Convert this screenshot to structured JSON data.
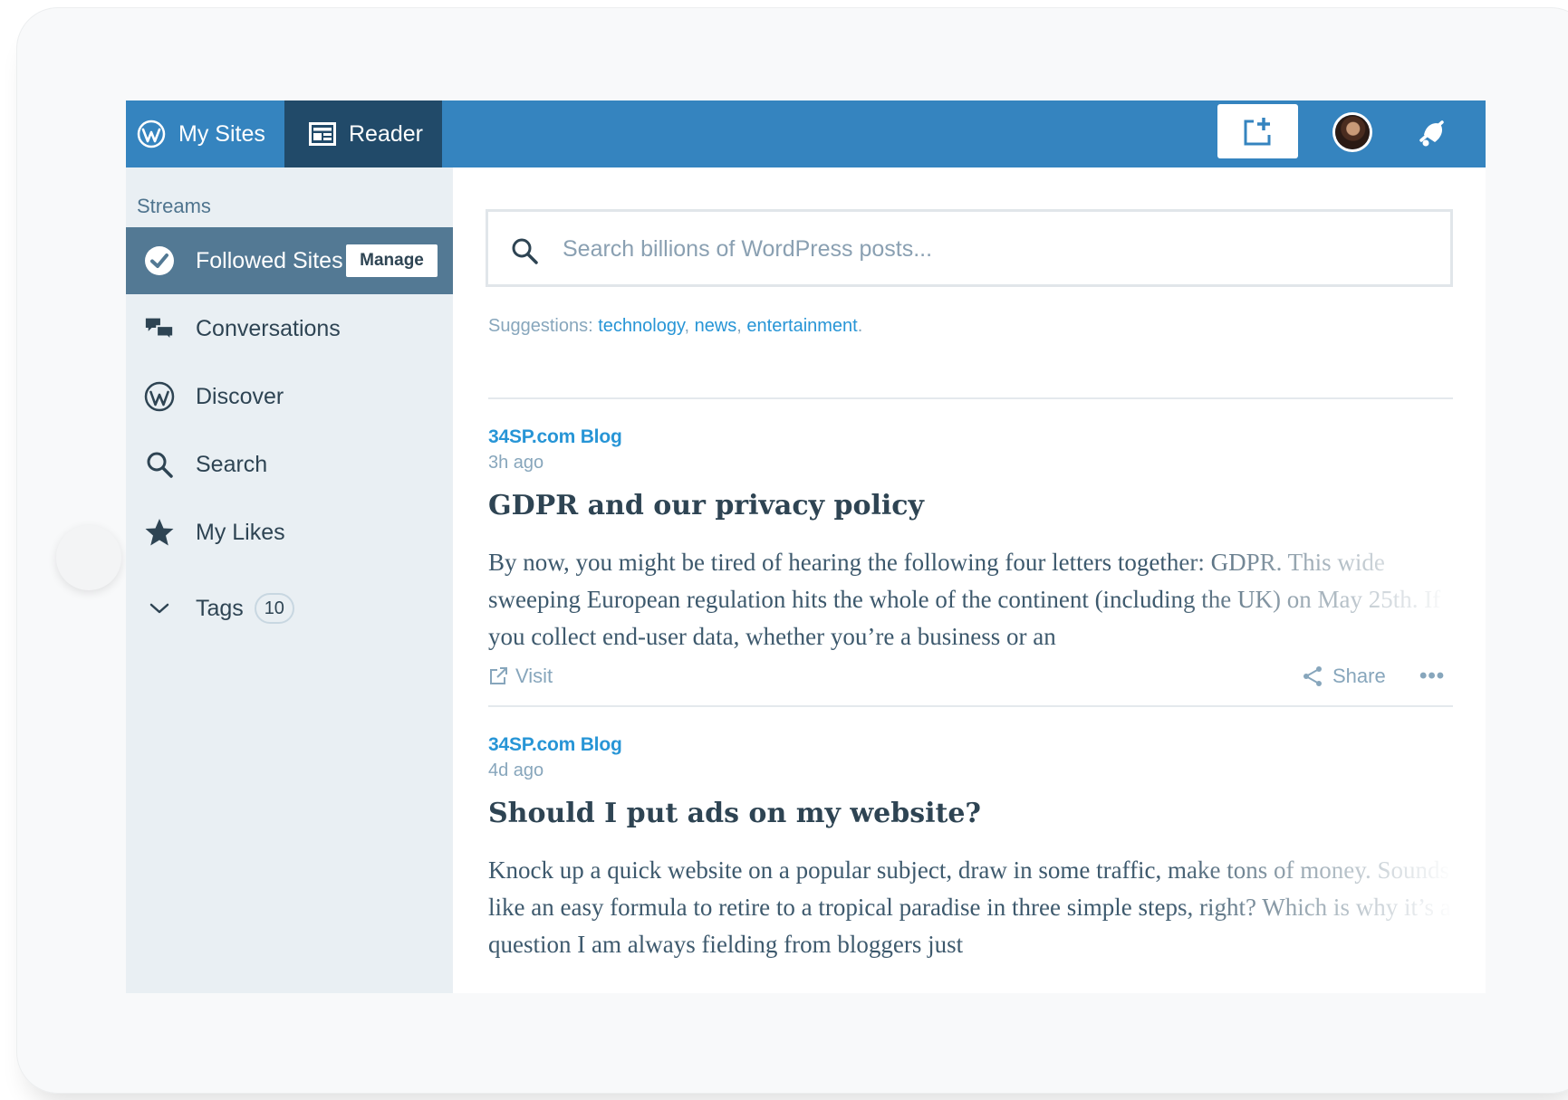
{
  "masterbar": {
    "my_sites_label": "My Sites",
    "reader_label": "Reader",
    "write_icon": "write-post-icon",
    "avatar_icon": "user-avatar",
    "notifications_icon": "notifications-bell-icon",
    "colors": {
      "bar": "#3584bf",
      "active_tab": "#214a69"
    }
  },
  "sidebar": {
    "streams_label": "Streams",
    "items": [
      {
        "label": "Followed Sites",
        "icon": "checkmark-circle-icon",
        "active": true,
        "action_label": "Manage"
      },
      {
        "label": "Conversations",
        "icon": "conversations-icon"
      },
      {
        "label": "Discover",
        "icon": "wordpress-logo-icon"
      },
      {
        "label": "Search",
        "icon": "search-icon"
      },
      {
        "label": "My Likes",
        "icon": "star-icon"
      }
    ],
    "tags": {
      "label": "Tags",
      "count": "10",
      "icon": "chevron-down-icon"
    }
  },
  "search": {
    "placeholder": "Search billions of WordPress posts...",
    "value": ""
  },
  "suggestions": {
    "label": "Suggestions:",
    "items": [
      "technology",
      "news",
      "entertainment"
    ]
  },
  "posts": [
    {
      "site": "34SP.com Blog",
      "time": "3h ago",
      "title": "GDPR and our privacy policy",
      "excerpt": "By now, you might be tired of hearing the following four letters together: GDPR. This wide sweeping European regulation hits the whole of the continent (including the UK) on May 25th. If you collect end-user data, whether you’re a business or an",
      "visit_label": "Visit",
      "share_label": "Share",
      "more_label": "•••"
    },
    {
      "site": "34SP.com Blog",
      "time": "4d ago",
      "title": "Should I put ads on my website?",
      "excerpt": "Knock up a quick website on a popular subject, draw in some traffic, make tons of money. Sounds like an easy formula to retire to a tropical paradise in three simple steps, right? Which is why it’s a question I am always fielding from bloggers just"
    }
  ]
}
